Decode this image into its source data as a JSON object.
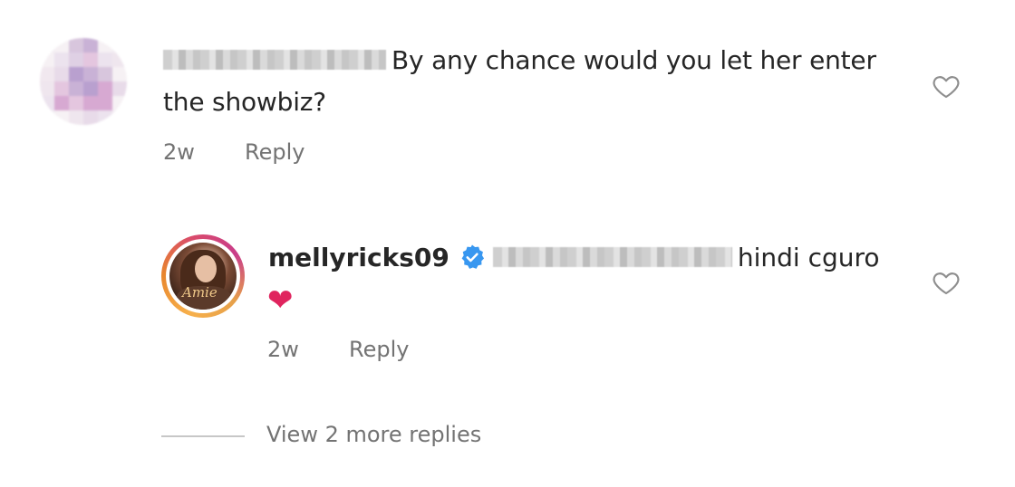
{
  "comment": {
    "text": "By any chance would you let her enter the showbiz?",
    "time": "2w",
    "reply_label": "Reply",
    "like_icon": "heart-outline-icon"
  },
  "reply": {
    "username": "mellyricks09",
    "avatar_script": "Amie",
    "text": "hindi cguro",
    "emoji": "❤",
    "time": "2w",
    "reply_label": "Reply",
    "verified_icon": "verified-badge-icon",
    "like_icon": "heart-outline-icon"
  },
  "view_more": {
    "label": "View 2 more replies"
  },
  "colors": {
    "text": "#262626",
    "muted": "#737373",
    "verified": "#3897f0",
    "heart": "#e0245e"
  }
}
